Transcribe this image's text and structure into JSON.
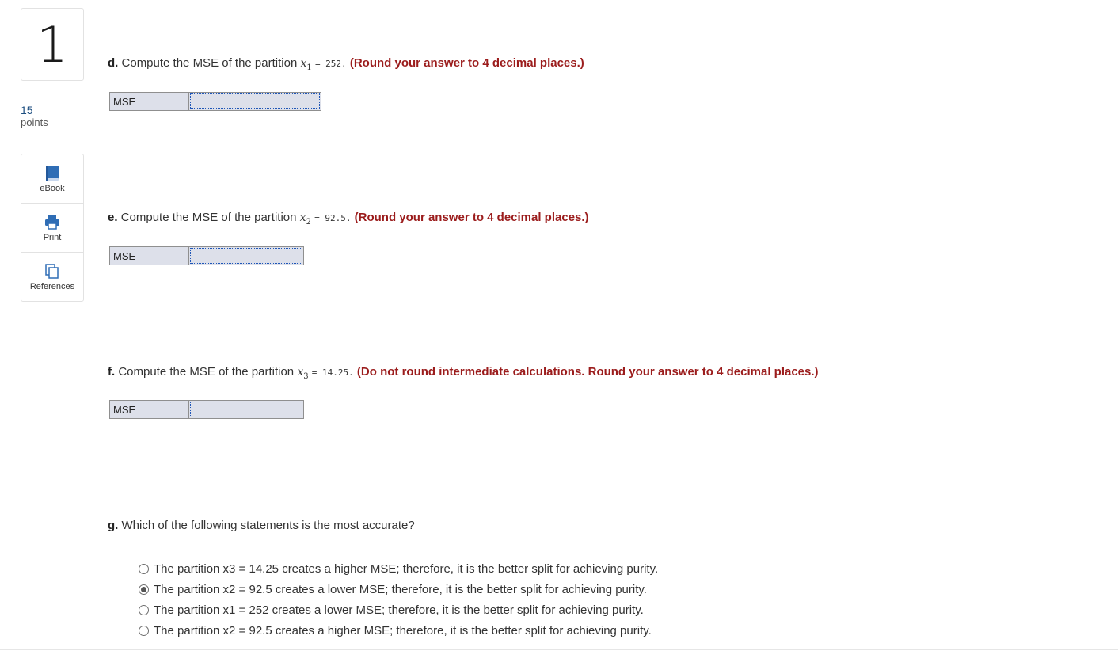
{
  "question": {
    "number": "1",
    "points_value": "15",
    "points_label": "points"
  },
  "tools": [
    {
      "label": "eBook",
      "icon": "book-icon"
    },
    {
      "label": "Print",
      "icon": "printer-icon"
    },
    {
      "label": "References",
      "icon": "copy-pages-icon"
    }
  ],
  "parts": {
    "d": {
      "letter": "d.",
      "prompt": "Compute the MSE of the partition",
      "var": "x",
      "sub": "1",
      "equals": "= 252.",
      "instruction": "(Round your answer to 4 decimal places.)",
      "field_label": "MSE",
      "value": ""
    },
    "e": {
      "letter": "e.",
      "prompt": "Compute the MSE of the partition",
      "var": "x",
      "sub": "2",
      "equals": "= 92.5.",
      "instruction": "(Round your answer to 4 decimal places.)",
      "field_label": "MSE",
      "value": ""
    },
    "f": {
      "letter": "f.",
      "prompt": "Compute the MSE of the partition",
      "var": "x",
      "sub": "3",
      "equals": "= 14.25.",
      "instruction": "(Do not round intermediate calculations. Round your answer to 4 decimal places.)",
      "field_label": "MSE",
      "value": ""
    },
    "g": {
      "letter": "g.",
      "prompt": "Which of the following statements is the most accurate?",
      "options": [
        {
          "text": "The partition x3 = 14.25 creates a higher MSE; therefore, it is the better split for achieving purity.",
          "selected": false
        },
        {
          "text": "The partition x2 = 92.5 creates a lower MSE; therefore, it is the better split for achieving purity.",
          "selected": true
        },
        {
          "text": "The partition x1 = 252 creates a lower MSE; therefore, it is the better split for achieving purity.",
          "selected": false
        },
        {
          "text": "The partition x2 = 92.5 creates a higher MSE; therefore, it is the better split for achieving purity.",
          "selected": false
        }
      ]
    }
  },
  "colors": {
    "instruction": "#9b1c1c",
    "field_bg": "#dde0ea",
    "icon_blue": "#2f6db5",
    "points_blue": "#1c4e80"
  }
}
